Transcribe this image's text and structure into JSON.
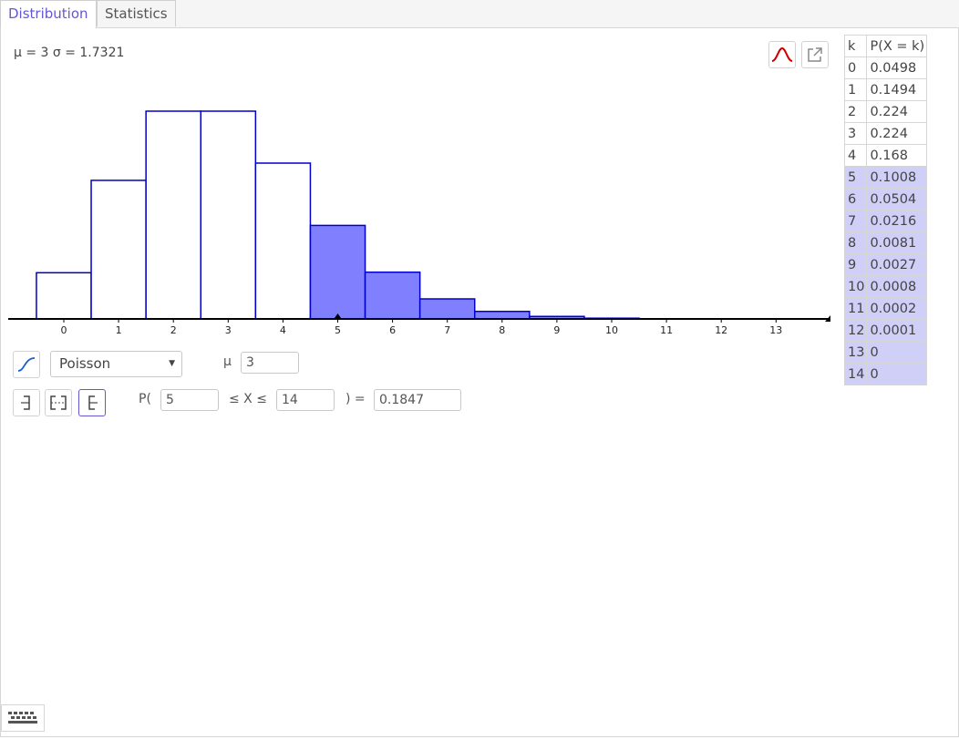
{
  "tabs": [
    {
      "label": "Distribution",
      "active": true
    },
    {
      "label": "Statistics",
      "active": false
    }
  ],
  "summary": "μ = 3 σ = 1.7321",
  "distribution": {
    "selected": "Poisson"
  },
  "parameter": {
    "label": "μ",
    "value": "3"
  },
  "probability": {
    "prefix": "P(",
    "lower": "5",
    "middle": "≤ X ≤",
    "upper": "14",
    "suffix": ") =",
    "result": "0.1847"
  },
  "table": {
    "headers": [
      "k",
      "P(X = k)"
    ],
    "rows": [
      {
        "k": "0",
        "p": "0.0498",
        "highlighted": false
      },
      {
        "k": "1",
        "p": "0.1494",
        "highlighted": false
      },
      {
        "k": "2",
        "p": "0.224",
        "highlighted": false
      },
      {
        "k": "3",
        "p": "0.224",
        "highlighted": false
      },
      {
        "k": "4",
        "p": "0.168",
        "highlighted": false
      },
      {
        "k": "5",
        "p": "0.1008",
        "highlighted": true
      },
      {
        "k": "6",
        "p": "0.0504",
        "highlighted": true
      },
      {
        "k": "7",
        "p": "0.0216",
        "highlighted": true
      },
      {
        "k": "8",
        "p": "0.0081",
        "highlighted": true
      },
      {
        "k": "9",
        "p": "0.0027",
        "highlighted": true
      },
      {
        "k": "10",
        "p": "0.0008",
        "highlighted": true
      },
      {
        "k": "11",
        "p": "0.0002",
        "highlighted": true
      },
      {
        "k": "12",
        "p": "0.0001",
        "highlighted": true
      },
      {
        "k": "13",
        "p": "0",
        "highlighted": true
      },
      {
        "k": "14",
        "p": "0",
        "highlighted": true
      }
    ]
  },
  "icons": {
    "distribution_curve": "normal-curve-icon",
    "export": "export-icon",
    "cumulative": "cumulative-icon",
    "left_sided": "left-bracket-icon",
    "interval": "interval-bracket-icon",
    "right_sided": "right-bracket-icon",
    "keyboard": "keyboard-icon"
  },
  "colors": {
    "accent": "#6557d2",
    "bar_stroke": "#0000cc",
    "bar_fill_selected": "#8080ff",
    "table_highlight": "#cfcff7",
    "curve_red": "#d00000"
  },
  "chart_data": {
    "type": "bar",
    "categories": [
      "0",
      "1",
      "2",
      "3",
      "4",
      "5",
      "6",
      "7",
      "8",
      "9",
      "10",
      "11",
      "12",
      "13"
    ],
    "values": [
      0.0498,
      0.1494,
      0.224,
      0.224,
      0.168,
      0.1008,
      0.0504,
      0.0216,
      0.0081,
      0.0027,
      0.0008,
      0.0002,
      0.0001,
      0
    ],
    "highlight_range": [
      5,
      14
    ],
    "xlim": [
      -0.5,
      14
    ],
    "ylim": [
      0,
      0.224
    ],
    "title": "",
    "xlabel": "",
    "ylabel": ""
  }
}
